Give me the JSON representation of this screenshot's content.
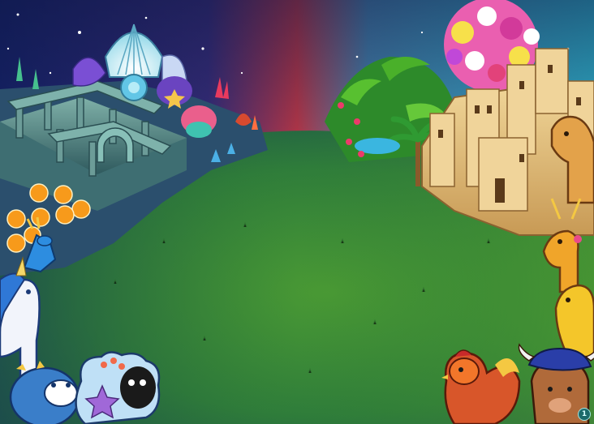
{
  "scene": {
    "name": "farm-expansion-background",
    "sky_left_color": "#1c2a78",
    "sky_mid_color": "#c23a4a",
    "sky_right_color": "#3fb7c9",
    "grass_color": "#3f8a2e",
    "grass_dark_color": "#1f5a46"
  },
  "corner_badge": {
    "label": "1"
  },
  "icons": [
    "ocean-ruins-temple",
    "giant-seashell",
    "coral-reef",
    "orange-slice-flowers",
    "sea-unicorn",
    "starfish-sheep",
    "desert-palace",
    "flower-tree",
    "palm-trees",
    "camel",
    "golden-antelope",
    "golden-horse",
    "desert-rooster",
    "turban-bull"
  ]
}
